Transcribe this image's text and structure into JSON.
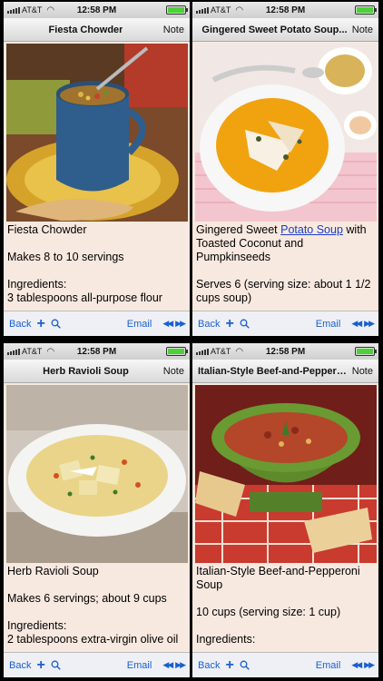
{
  "status": {
    "carrier": "AT&T",
    "time": "12:58 PM"
  },
  "navbar": {
    "note": "Note"
  },
  "toolbar": {
    "back": "Back",
    "email": "Email"
  },
  "screens": [
    {
      "title": "Fiesta Chowder",
      "lines": [
        "Fiesta Chowder",
        "Makes 8 to 10 servings",
        "Ingredients:",
        "3 tablespoons all-purpose flour"
      ]
    },
    {
      "title": "Gingered Sweet Potato Soup...",
      "heading_pre": "Gingered Sweet ",
      "heading_link": "Potato Soup",
      "heading_post": " with Toasted Coconut and Pumpkinseeds",
      "lines": [
        "Serves 6 (serving size: about 1 1/2 cups soup)"
      ]
    },
    {
      "title": "Herb Ravioli Soup",
      "lines": [
        "Herb Ravioli Soup",
        "Makes 6 servings; about 9 cups",
        "Ingredients:",
        "2 tablespoons extra-virgin olive oil"
      ]
    },
    {
      "title": "Italian-Style Beef-and-Pepperoni...",
      "lines": [
        "Italian-Style Beef-and-Pepperoni Soup",
        "10 cups (serving size: 1 cup)",
        "Ingredients:"
      ]
    }
  ],
  "icons": [
    "magnifier-icon",
    "plus-icon",
    "previous-icon",
    "next-icon",
    "wifi-icon",
    "battery-icon"
  ]
}
